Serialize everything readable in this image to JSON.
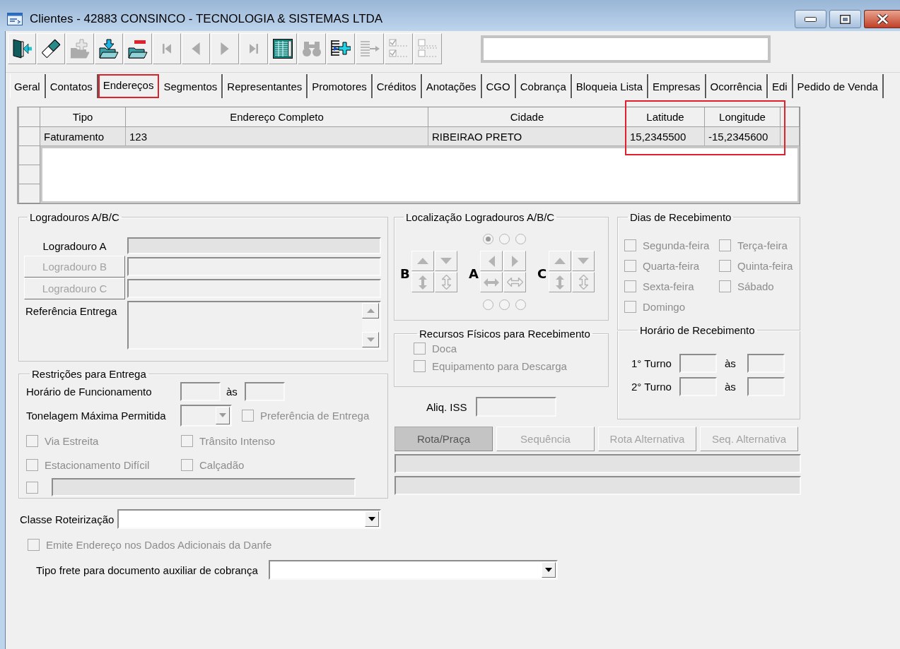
{
  "window": {
    "title": "Clientes - 42883 CONSINCO - TECNOLOGIA & SISTEMAS LTDA"
  },
  "toolbar": [
    {
      "disabled": false
    },
    {
      "disabled": false
    },
    {
      "disabled": true
    },
    {
      "disabled": false
    },
    {
      "disabled": false
    },
    {
      "disabled": true
    },
    {
      "disabled": true
    },
    {
      "disabled": true
    },
    {
      "disabled": true
    },
    {
      "disabled": false
    },
    {
      "disabled": true
    },
    {
      "disabled": false
    },
    {
      "disabled": true
    },
    {
      "disabled": true
    },
    {
      "disabled": true
    }
  ],
  "tabs": [
    {
      "label": "Geral",
      "selected": false,
      "highlighted": false
    },
    {
      "label": "Contatos",
      "selected": false,
      "highlighted": false
    },
    {
      "label": "Endereços",
      "selected": true,
      "highlighted": true
    },
    {
      "label": "Segmentos",
      "selected": false,
      "highlighted": false
    },
    {
      "label": "Representantes",
      "selected": false,
      "highlighted": false
    },
    {
      "label": "Promotores",
      "selected": false,
      "highlighted": false
    },
    {
      "label": "Créditos",
      "selected": false,
      "highlighted": false
    },
    {
      "label": "Anotações",
      "selected": false,
      "highlighted": false
    },
    {
      "label": "CGO",
      "selected": false,
      "highlighted": false
    },
    {
      "label": "Cobrança",
      "selected": false,
      "highlighted": false
    },
    {
      "label": "Bloqueia Lista",
      "selected": false,
      "highlighted": false
    },
    {
      "label": "Empresas",
      "selected": false,
      "highlighted": false
    },
    {
      "label": "Ocorrência",
      "selected": false,
      "highlighted": false
    },
    {
      "label": "Edi",
      "selected": false,
      "highlighted": false
    },
    {
      "label": "Pedido de Venda",
      "selected": false,
      "highlighted": false
    }
  ],
  "grid": {
    "columns": [
      {
        "label": "Tipo",
        "highlighted": false
      },
      {
        "label": "Endereço Completo",
        "highlighted": false
      },
      {
        "label": "Cidade",
        "highlighted": false
      },
      {
        "label": "Latitude",
        "highlighted": true
      },
      {
        "label": "Longitude",
        "highlighted": true
      }
    ],
    "rows": [
      [
        "Faturamento",
        "123",
        "RIBEIRAO PRETO",
        "15,2345500",
        "-15,2345600"
      ]
    ]
  },
  "logradouros": {
    "title": "Logradouros A/B/C",
    "rows": [
      {
        "kind": "label",
        "label": "Logradouro A"
      },
      {
        "kind": "button",
        "label": "Logradouro B",
        "disabled": true
      },
      {
        "kind": "button",
        "label": "Logradouro C",
        "disabled": true
      }
    ],
    "reference_label": "Referência Entrega"
  },
  "restricoes": {
    "title": "Restrições para Entrega",
    "hours_label": "Horário de Funcionamento",
    "hours_separator": "às",
    "tonnage_label": "Tonelagem Máxima Permitida",
    "preference": {
      "label": "Preferência de Entrega",
      "checked": false,
      "disabled": true
    },
    "options": [
      {
        "label": "Via Estreita",
        "checked": false,
        "disabled": true
      },
      {
        "label": "Trânsito Intenso",
        "checked": false,
        "disabled": true
      },
      {
        "label": "Estacionamento Difícil",
        "checked": false,
        "disabled": true
      },
      {
        "label": "Calçadão",
        "checked": false,
        "disabled": true
      }
    ],
    "other": {
      "checked": false,
      "disabled": true
    }
  },
  "localizacao": {
    "title": "Localização Logradouros A/B/C",
    "disabled": true,
    "radios_top": [
      {
        "selected": true
      },
      {
        "selected": false
      },
      {
        "selected": false
      }
    ],
    "groups": [
      {
        "letter": "B",
        "kind": "vertical"
      },
      {
        "letter": "A",
        "kind": "horizontal"
      },
      {
        "letter": "C",
        "kind": "vertical"
      }
    ],
    "radios_bottom": [
      {
        "selected": false
      },
      {
        "selected": false
      },
      {
        "selected": false
      }
    ]
  },
  "recursos": {
    "title": "Recursos Físicos para Recebimento",
    "options": [
      {
        "label": "Doca",
        "checked": false,
        "disabled": true
      },
      {
        "label": "Equipamento para Descarga",
        "checked": false,
        "disabled": true
      }
    ]
  },
  "aliq_iss": {
    "label": "Aliq. ISS"
  },
  "dias": {
    "title": "Dias de Recebimento",
    "days": [
      {
        "label": "Segunda-feira",
        "checked": false,
        "disabled": true
      },
      {
        "label": "Terça-feira",
        "checked": false,
        "disabled": true
      },
      {
        "label": "Quarta-feira",
        "checked": false,
        "disabled": true
      },
      {
        "label": "Quinta-feira",
        "checked": false,
        "disabled": true
      },
      {
        "label": "Sexta-feira",
        "checked": false,
        "disabled": true
      },
      {
        "label": "Sábado",
        "checked": false,
        "disabled": true
      },
      {
        "label": "Domingo",
        "checked": false,
        "disabled": true
      }
    ],
    "horario": {
      "title": "Horário de Recebimento",
      "shifts": [
        {
          "label": "1° Turno",
          "separator": "às"
        },
        {
          "label": "2° Turno",
          "separator": "às"
        }
      ]
    }
  },
  "route_buttons": [
    {
      "label": "Rota/Praça",
      "selected": true,
      "disabled": true
    },
    {
      "label": "Sequência",
      "selected": false,
      "disabled": true
    },
    {
      "label": "Rota Alternativa",
      "selected": false,
      "disabled": true
    },
    {
      "label": "Seq. Alternativa",
      "selected": false,
      "disabled": true
    }
  ],
  "classe_roteirizacao": {
    "label": "Classe Roteirização"
  },
  "emite_endereco": {
    "label": "Emite Endereço nos Dados Adicionais da Danfe",
    "checked": false,
    "disabled": true
  },
  "tipo_frete": {
    "label": "Tipo frete para documento auxiliar de cobrança"
  }
}
